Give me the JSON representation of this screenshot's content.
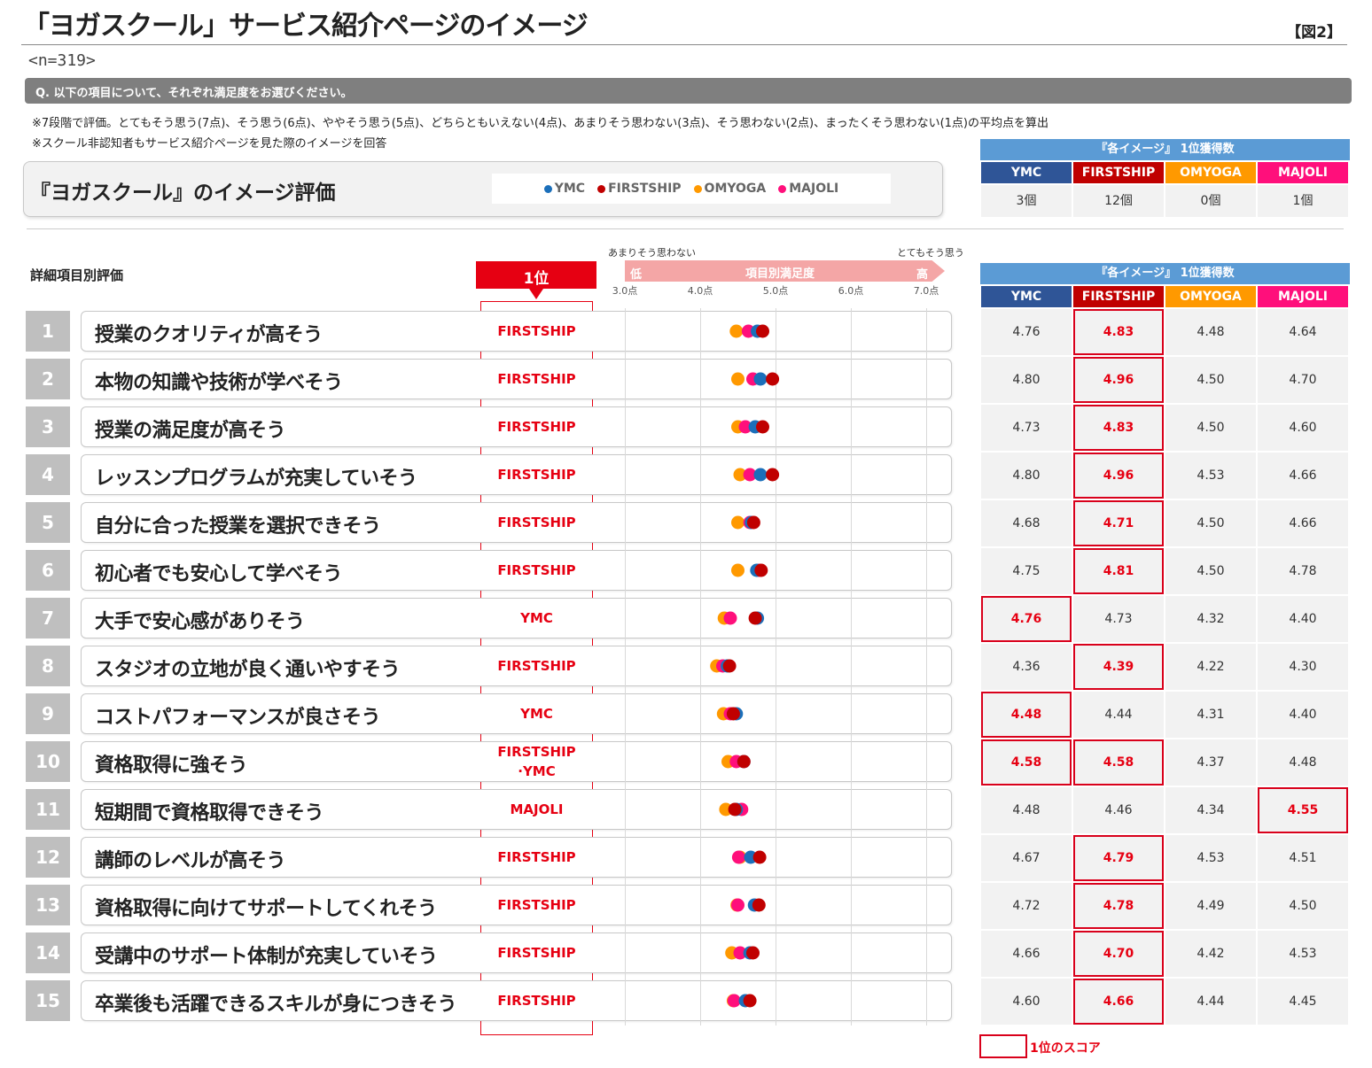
{
  "header": {
    "title": "「ヨガスクール」サービス紹介ページのイメージ",
    "figure_label": "【図2】",
    "sample_size": "<n=319>"
  },
  "question": "Q. 以下の項目について、それぞれ満足度をお選びください。",
  "notes": [
    "※7段階で評価。とてもそう思う(7点)、そう思う(6点)、ややそう思う(5点)、どちらともいえない(4点)、あまりそう思わない(3点)、そう思わない(2点)、まったくそう思わない(1点)の平均点を算出",
    "※スクール非認知者もサービス紹介ページを見た際のイメージを回答"
  ],
  "evaluation_title": "『ヨガスクール』のイメージ評価",
  "detail_label": "詳細項目別評価",
  "rank_header": "1位",
  "scale": {
    "low_text": "あまりそう思わない",
    "high_text": "とてもそう思う",
    "title": "項目別満足度",
    "low": "低",
    "high": "高",
    "ticks": [
      "3.0点",
      "4.0点",
      "5.0点",
      "6.0点",
      "7.0点"
    ]
  },
  "colors": {
    "YMC": "#1b6fba",
    "FIRSTSHIP": "#c00000",
    "OMYOGA": "#ff9900",
    "MAJOLI": "#ff0f7b",
    "accent": "#e60012",
    "table_header": "#5b9bd5",
    "ymc_header": "#2f5597"
  },
  "summary": {
    "title": "『各イメージ』 1位獲得数",
    "counts": [
      "3個",
      "12個",
      "0個",
      "1個"
    ]
  },
  "detail_table_title": "『各イメージ』 1位獲得数",
  "footer_legend": "1位のスコア",
  "chart_data": {
    "type": "scatter",
    "title": "『ヨガスクール』のイメージ評価",
    "xlabel": "項目別満足度",
    "xlim": [
      3.0,
      7.0
    ],
    "x_ticks": [
      "3.0点",
      "4.0点",
      "5.0点",
      "6.0点",
      "7.0点"
    ],
    "series_names": [
      "YMC",
      "FIRSTSHIP",
      "OMYOGA",
      "MAJOLI"
    ],
    "items": [
      {
        "num": "1",
        "label": "授業のクオリティが高そう",
        "rank1": "FIRSTSHIP",
        "values": [
          4.76,
          4.83,
          4.48,
          4.64
        ],
        "display": [
          "4.76",
          "4.83",
          "4.48",
          "4.64"
        ],
        "winners": [
          1
        ]
      },
      {
        "num": "2",
        "label": "本物の知識や技術が学べそう",
        "rank1": "FIRSTSHIP",
        "values": [
          4.8,
          4.96,
          4.5,
          4.7
        ],
        "display": [
          "4.80",
          "4.96",
          "4.50",
          "4.70"
        ],
        "winners": [
          1
        ]
      },
      {
        "num": "3",
        "label": "授業の満足度が高そう",
        "rank1": "FIRSTSHIP",
        "values": [
          4.73,
          4.83,
          4.5,
          4.6
        ],
        "display": [
          "4.73",
          "4.83",
          "4.50",
          "4.60"
        ],
        "winners": [
          1
        ]
      },
      {
        "num": "4",
        "label": "レッスンプログラムが充実していそう",
        "rank1": "FIRSTSHIP",
        "values": [
          4.8,
          4.96,
          4.53,
          4.66
        ],
        "display": [
          "4.80",
          "4.96",
          "4.53",
          "4.66"
        ],
        "winners": [
          1
        ]
      },
      {
        "num": "5",
        "label": "自分に合った授業を選択できそう",
        "rank1": "FIRSTSHIP",
        "values": [
          4.68,
          4.71,
          4.5,
          4.66
        ],
        "display": [
          "4.68",
          "4.71",
          "4.50",
          "4.66"
        ],
        "winners": [
          1
        ]
      },
      {
        "num": "6",
        "label": "初心者でも安心して学べそう",
        "rank1": "FIRSTSHIP",
        "values": [
          4.75,
          4.81,
          4.5,
          4.78
        ],
        "display": [
          "4.75",
          "4.81",
          "4.50",
          "4.78"
        ],
        "winners": [
          1
        ]
      },
      {
        "num": "7",
        "label": "大手で安心感がありそう",
        "rank1": "YMC",
        "values": [
          4.76,
          4.73,
          4.32,
          4.4
        ],
        "display": [
          "4.76",
          "4.73",
          "4.32",
          "4.40"
        ],
        "winners": [
          0
        ]
      },
      {
        "num": "8",
        "label": "スタジオの立地が良く通いやすそう",
        "rank1": "FIRSTSHIP",
        "values": [
          4.36,
          4.39,
          4.22,
          4.3
        ],
        "display": [
          "4.36",
          "4.39",
          "4.22",
          "4.30"
        ],
        "winners": [
          1
        ]
      },
      {
        "num": "9",
        "label": "コストパフォーマンスが良さそう",
        "rank1": "YMC",
        "values": [
          4.48,
          4.44,
          4.31,
          4.4
        ],
        "display": [
          "4.48",
          "4.44",
          "4.31",
          "4.40"
        ],
        "winners": [
          0
        ]
      },
      {
        "num": "10",
        "label": "資格取得に強そう",
        "rank1": "FIRSTSHIP\n·YMC",
        "values": [
          4.58,
          4.58,
          4.37,
          4.48
        ],
        "display": [
          "4.58",
          "4.58",
          "4.37",
          "4.48"
        ],
        "winners": [
          0,
          1
        ]
      },
      {
        "num": "11",
        "label": "短期間で資格取得できそう",
        "rank1": "MAJOLI",
        "values": [
          4.48,
          4.46,
          4.34,
          4.55
        ],
        "display": [
          "4.48",
          "4.46",
          "4.34",
          "4.55"
        ],
        "winners": [
          3
        ]
      },
      {
        "num": "12",
        "label": "講師のレベルが高そう",
        "rank1": "FIRSTSHIP",
        "values": [
          4.67,
          4.79,
          4.53,
          4.51
        ],
        "display": [
          "4.67",
          "4.79",
          "4.53",
          "4.51"
        ],
        "winners": [
          1
        ]
      },
      {
        "num": "13",
        "label": "資格取得に向けてサポートしてくれそう",
        "rank1": "FIRSTSHIP",
        "values": [
          4.72,
          4.78,
          4.49,
          4.5
        ],
        "display": [
          "4.72",
          "4.78",
          "4.49",
          "4.50"
        ],
        "winners": [
          1
        ]
      },
      {
        "num": "14",
        "label": "受講中のサポート体制が充実していそう",
        "rank1": "FIRSTSHIP",
        "values": [
          4.66,
          4.7,
          4.42,
          4.53
        ],
        "display": [
          "4.66",
          "4.70",
          "4.42",
          "4.53"
        ],
        "winners": [
          1
        ]
      },
      {
        "num": "15",
        "label": "卒業後も活躍できるスキルが身につきそう",
        "rank1": "FIRSTSHIP",
        "values": [
          4.6,
          4.66,
          4.44,
          4.45
        ],
        "display": [
          "4.60",
          "4.66",
          "4.44",
          "4.45"
        ],
        "winners": [
          1
        ]
      }
    ]
  }
}
